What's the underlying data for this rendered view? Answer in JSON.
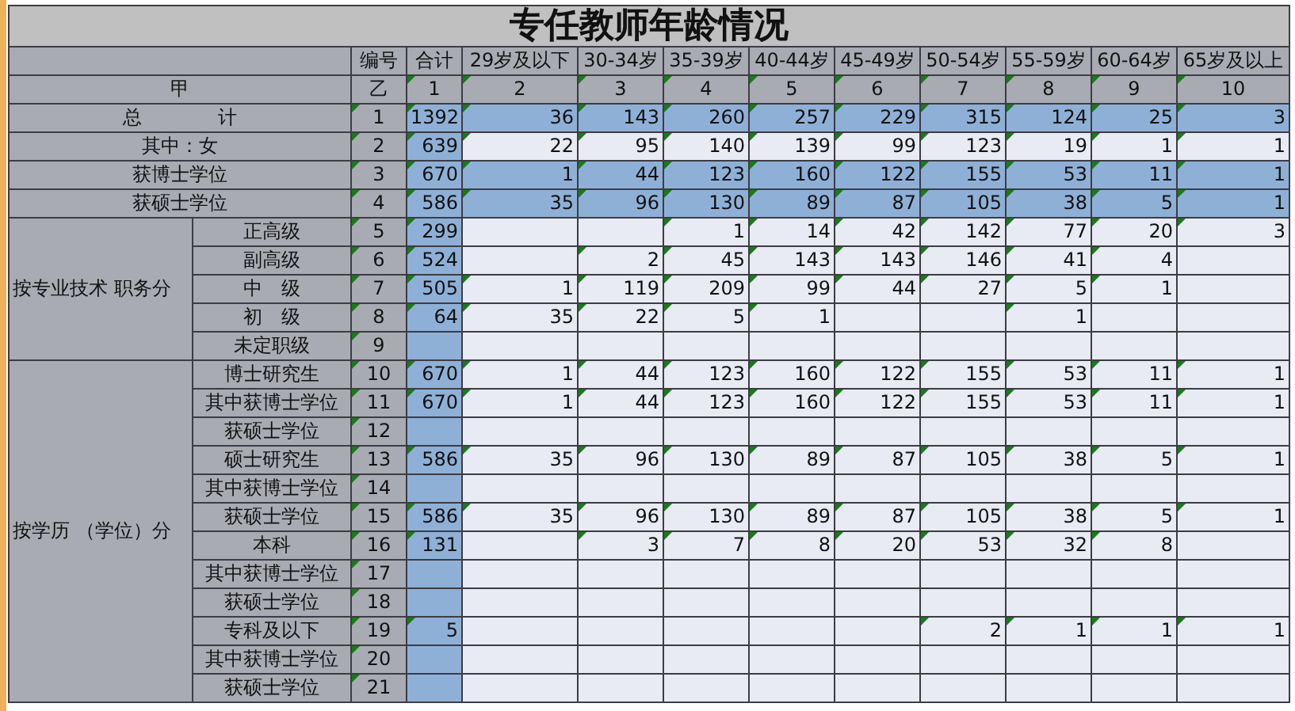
{
  "title": "专任教师年龄情况",
  "header": {
    "code": "编号",
    "total": "合计",
    "ages": [
      "29岁及以下",
      "30-34岁",
      "35-39岁",
      "40-44岁",
      "45-49岁",
      "50-54岁",
      "55-59岁",
      "60-64岁",
      "65岁及以上"
    ]
  },
  "index_row": {
    "label_a": "甲",
    "label_b": "乙",
    "numbers": [
      "1",
      "2",
      "3",
      "4",
      "5",
      "6",
      "7",
      "8",
      "9",
      "10"
    ]
  },
  "summary_rows": [
    {
      "label": "总　　　　计",
      "code": "1",
      "values": {
        "col_1": "1392",
        "col_2": "36",
        "col_3": "143",
        "col_4": "260",
        "col_5": "257",
        "col_6": "229",
        "col_7": "315",
        "col_8": "124",
        "col_9": "25",
        "col_10": "3"
      },
      "highlighted": true
    },
    {
      "label": "其中：女",
      "code": "2",
      "values": {
        "col_1": "639",
        "col_2": "22",
        "col_3": "95",
        "col_4": "140",
        "col_5": "139",
        "col_6": "99",
        "col_7": "123",
        "col_8": "19",
        "col_9": "1",
        "col_10": "1"
      },
      "highlighted": false
    },
    {
      "label": "获博士学位",
      "code": "3",
      "values": {
        "col_1": "670",
        "col_2": "1",
        "col_3": "44",
        "col_4": "123",
        "col_5": "160",
        "col_6": "122",
        "col_7": "155",
        "col_8": "53",
        "col_9": "11",
        "col_10": "1"
      },
      "highlighted": true
    },
    {
      "label": "获硕士学位",
      "code": "4",
      "values": {
        "col_1": "586",
        "col_2": "35",
        "col_3": "96",
        "col_4": "130",
        "col_5": "89",
        "col_6": "87",
        "col_7": "105",
        "col_8": "38",
        "col_9": "5",
        "col_10": "1"
      },
      "highlighted": true
    }
  ],
  "groups": [
    {
      "label": "按专业技术 职务分",
      "rows": [
        {
          "label": "正高级",
          "code": "5",
          "values": {
            "col_1": "299",
            "col_4": "1",
            "col_5": "14",
            "col_6": "42",
            "col_7": "142",
            "col_8": "77",
            "col_9": "20",
            "col_10": "3"
          }
        },
        {
          "label": "副高级",
          "code": "6",
          "values": {
            "col_1": "524",
            "col_3": "2",
            "col_4": "45",
            "col_5": "143",
            "col_6": "143",
            "col_7": "146",
            "col_8": "41",
            "col_9": "4"
          }
        },
        {
          "label": "中　级",
          "code": "7",
          "values": {
            "col_1": "505",
            "col_2": "1",
            "col_3": "119",
            "col_4": "209",
            "col_5": "99",
            "col_6": "44",
            "col_7": "27",
            "col_8": "5",
            "col_9": "1"
          }
        },
        {
          "label": "初　级",
          "code": "8",
          "values": {
            "col_1": "64",
            "col_2": "35",
            "col_3": "22",
            "col_4": "5",
            "col_5": "1",
            "col_8": "1"
          }
        },
        {
          "label": "未定职级",
          "code": "9"
        }
      ]
    },
    {
      "label": "按学历 （学位）分",
      "rows": [
        {
          "label": "博士研究生",
          "code": "10",
          "values": {
            "col_1": "670",
            "col_2": "1",
            "col_3": "44",
            "col_4": "123",
            "col_5": "160",
            "col_6": "122",
            "col_7": "155",
            "col_8": "53",
            "col_9": "11",
            "col_10": "1"
          }
        },
        {
          "label": "其中获博士学位",
          "code": "11",
          "values": {
            "col_1": "670",
            "col_2": "1",
            "col_3": "44",
            "col_4": "123",
            "col_5": "160",
            "col_6": "122",
            "col_7": "155",
            "col_8": "53",
            "col_9": "11",
            "col_10": "1"
          }
        },
        {
          "label": "获硕士学位",
          "code": "12"
        },
        {
          "label": "硕士研究生",
          "code": "13",
          "values": {
            "col_1": "586",
            "col_2": "35",
            "col_3": "96",
            "col_4": "130",
            "col_5": "89",
            "col_6": "87",
            "col_7": "105",
            "col_8": "38",
            "col_9": "5",
            "col_10": "1"
          }
        },
        {
          "label": "其中获博士学位",
          "code": "14"
        },
        {
          "label": "获硕士学位",
          "code": "15",
          "values": {
            "col_1": "586",
            "col_2": "35",
            "col_3": "96",
            "col_4": "130",
            "col_5": "89",
            "col_6": "87",
            "col_7": "105",
            "col_8": "38",
            "col_9": "5",
            "col_10": "1"
          }
        },
        {
          "label": "本科",
          "code": "16",
          "values": {
            "col_1": "131",
            "col_3": "3",
            "col_4": "7",
            "col_5": "8",
            "col_6": "20",
            "col_7": "53",
            "col_8": "32",
            "col_9": "8"
          }
        },
        {
          "label": "其中获博士学位",
          "code": "17"
        },
        {
          "label": "获硕士学位",
          "code": "18"
        },
        {
          "label": "专科及以下",
          "code": "19",
          "values": {
            "col_1": "5",
            "col_7": "2",
            "col_8": "1",
            "col_9": "1",
            "col_10": "1"
          }
        },
        {
          "label": "其中获博士学位",
          "code": "20"
        },
        {
          "label": "获硕士学位",
          "code": "21"
        }
      ]
    }
  ]
}
